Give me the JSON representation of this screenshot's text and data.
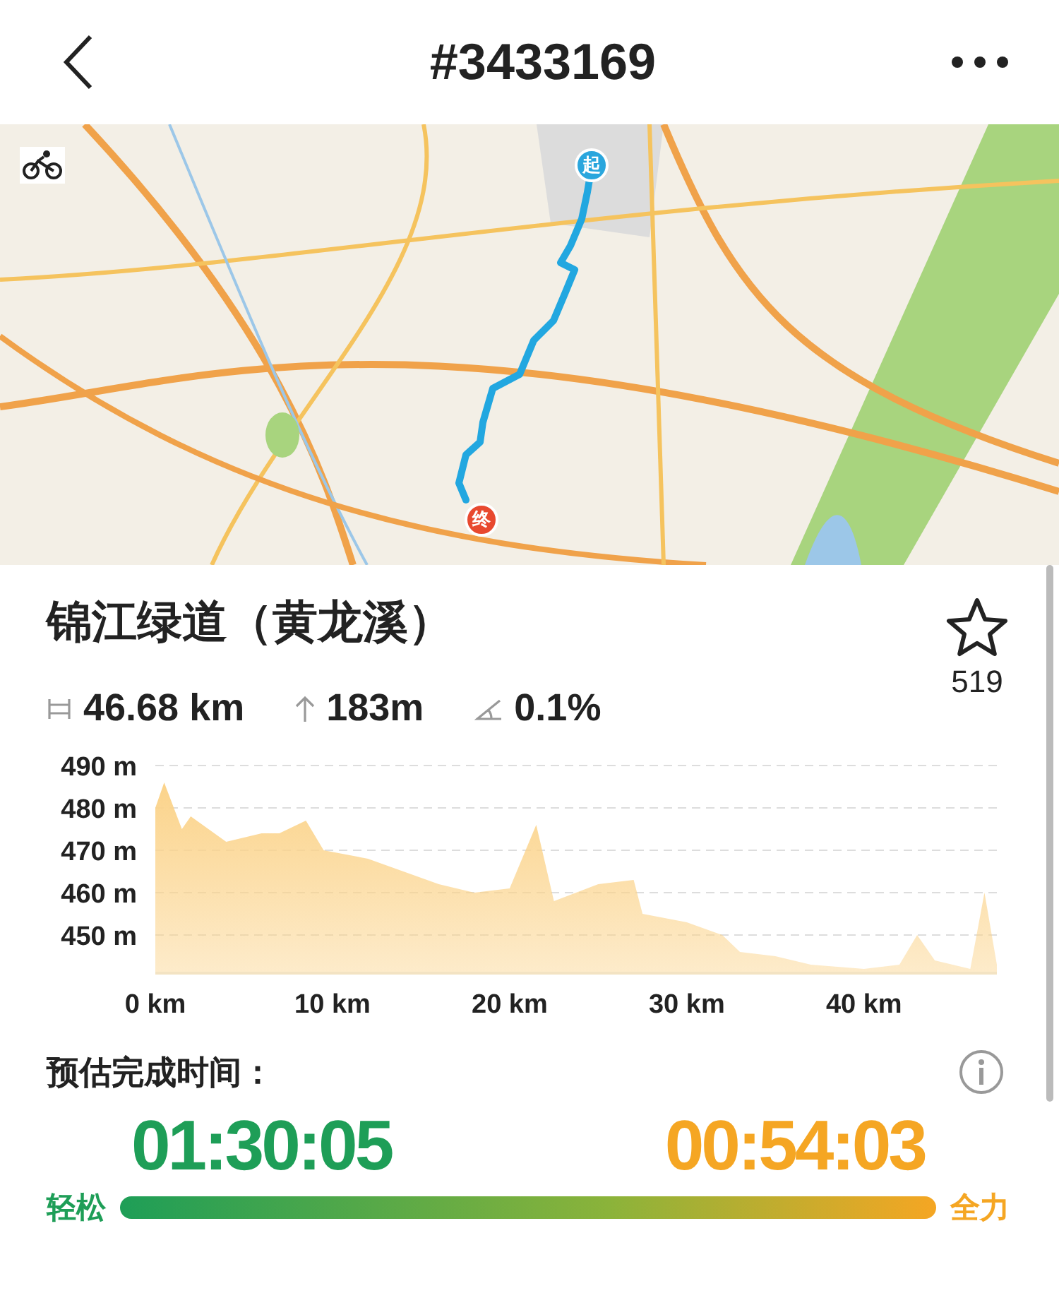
{
  "header": {
    "title": "#3433169"
  },
  "map": {
    "kind": "picture",
    "markers": [
      {
        "kind": "start",
        "label": "起"
      },
      {
        "kind": "end",
        "label": "终"
      }
    ]
  },
  "route": {
    "name": "锦江绿道（黄龙溪）",
    "favorited": false,
    "favorites": "519"
  },
  "stats": [
    {
      "kind": "distance",
      "value": "46.68 km"
    },
    {
      "kind": "climb",
      "value": "183m"
    },
    {
      "kind": "grade",
      "value": "0.1%"
    }
  ],
  "chart_data": {
    "type": "area",
    "x": [
      0,
      0.5,
      1.5,
      2,
      4,
      6,
      7,
      8.5,
      9.5,
      12,
      14,
      16,
      18,
      20,
      21.5,
      22.5,
      25,
      27,
      27.5,
      30,
      32,
      33,
      35,
      37,
      40,
      42,
      43,
      44,
      46,
      46.8,
      47.5
    ],
    "series": [
      {
        "color": "#fbd38a",
        "values": [
          480,
          486,
          475,
          478,
          472,
          474,
          474,
          477,
          470,
          468,
          465,
          462,
          460,
          461,
          476,
          458,
          462,
          463,
          455,
          453,
          450,
          446,
          445,
          443,
          442,
          443,
          450,
          444,
          442,
          460,
          443
        ]
      }
    ],
    "xlim": [
      0,
      47.5
    ],
    "ylim": [
      441,
      490
    ],
    "grid": true,
    "xticks": [
      {
        "value": 0,
        "label": "0 km"
      },
      {
        "value": 10,
        "label": "10 km"
      },
      {
        "value": 20,
        "label": "20 km"
      },
      {
        "value": 30,
        "label": "30 km"
      },
      {
        "value": 40,
        "label": "40 km"
      }
    ],
    "yticks": [
      {
        "value": 450,
        "label": "450 m"
      },
      {
        "value": 460,
        "label": "460 m"
      },
      {
        "value": 470,
        "label": "470 m"
      },
      {
        "value": 480,
        "label": "480 m"
      },
      {
        "value": 490,
        "label": "490 m"
      }
    ]
  },
  "estimate": {
    "label": "预估完成时间：",
    "easy": {
      "label": "轻松",
      "time": "01:30:05"
    },
    "max": {
      "label": "全力",
      "time": "00:54:03"
    }
  }
}
